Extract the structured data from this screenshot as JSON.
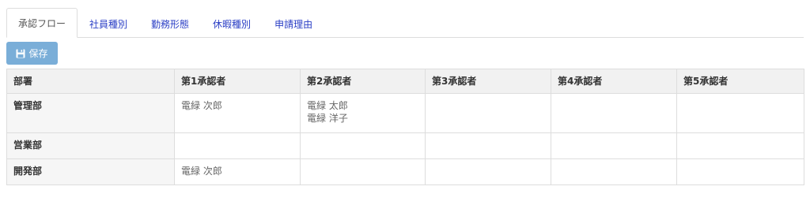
{
  "tabs": [
    "承認フロー",
    "社員種別",
    "勤務形態",
    "休暇種別",
    "申請理由"
  ],
  "active_tab_index": 0,
  "toolbar": {
    "save_label": "保存",
    "save_icon": "floppy-disk-icon",
    "accent": "#7aaed8"
  },
  "table": {
    "headers": [
      "部署",
      "第1承認者",
      "第2承認者",
      "第3承認者",
      "第4承認者",
      "第5承認者"
    ],
    "rows": [
      {
        "department": "管理部",
        "approvers": [
          [
            "電緑 次郎"
          ],
          [
            "電緑 太郎",
            "電緑 洋子"
          ],
          [],
          [],
          []
        ]
      },
      {
        "department": "営業部",
        "approvers": [
          [],
          [],
          [],
          [],
          []
        ]
      },
      {
        "department": "開発部",
        "approvers": [
          [
            "電緑 次郎"
          ],
          [],
          [],
          [],
          []
        ]
      }
    ]
  }
}
